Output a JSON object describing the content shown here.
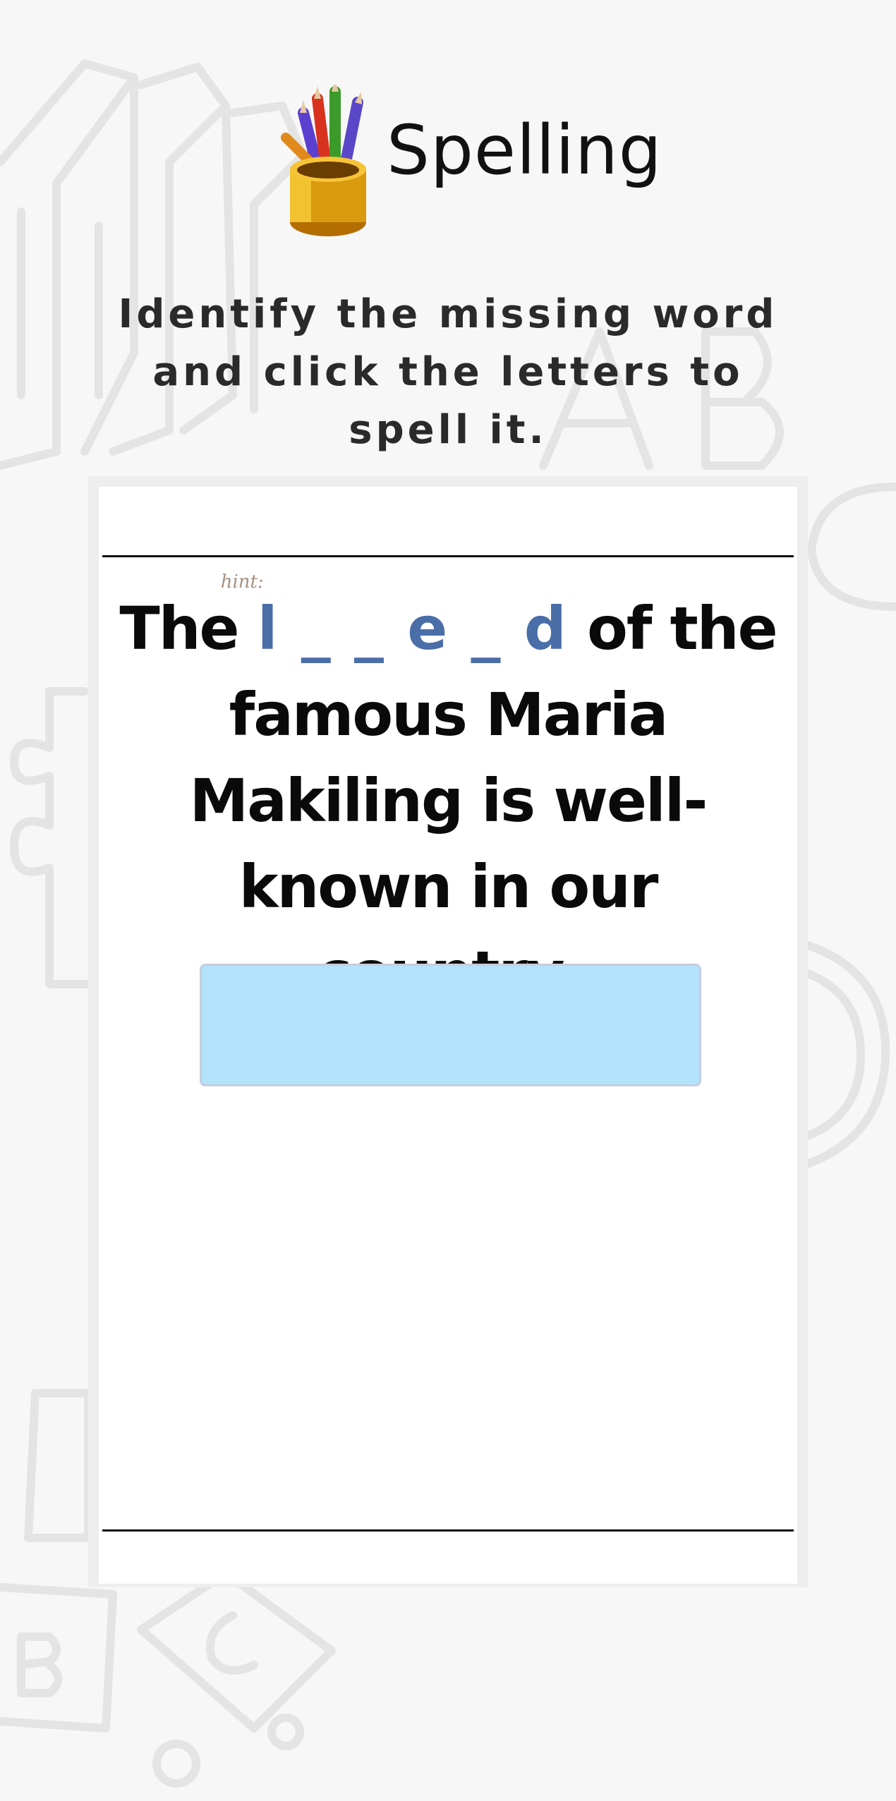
{
  "app": {
    "title": "Spelling",
    "icon": "pencil-cup-icon"
  },
  "instructions": "Identify the missing word and click the letters to spell it.",
  "question": {
    "before": "The",
    "hint_label": "hint:",
    "hint_letters": "l _ _ e _ d",
    "after": "of the famous Maria Makiling is well-known in our country."
  },
  "answer": {
    "value": ""
  },
  "colors": {
    "hint_letters": "#4a6ea8",
    "hint_label": "#a89080",
    "answer_box": "#b3e3fb",
    "background": "#f7f7f7"
  }
}
